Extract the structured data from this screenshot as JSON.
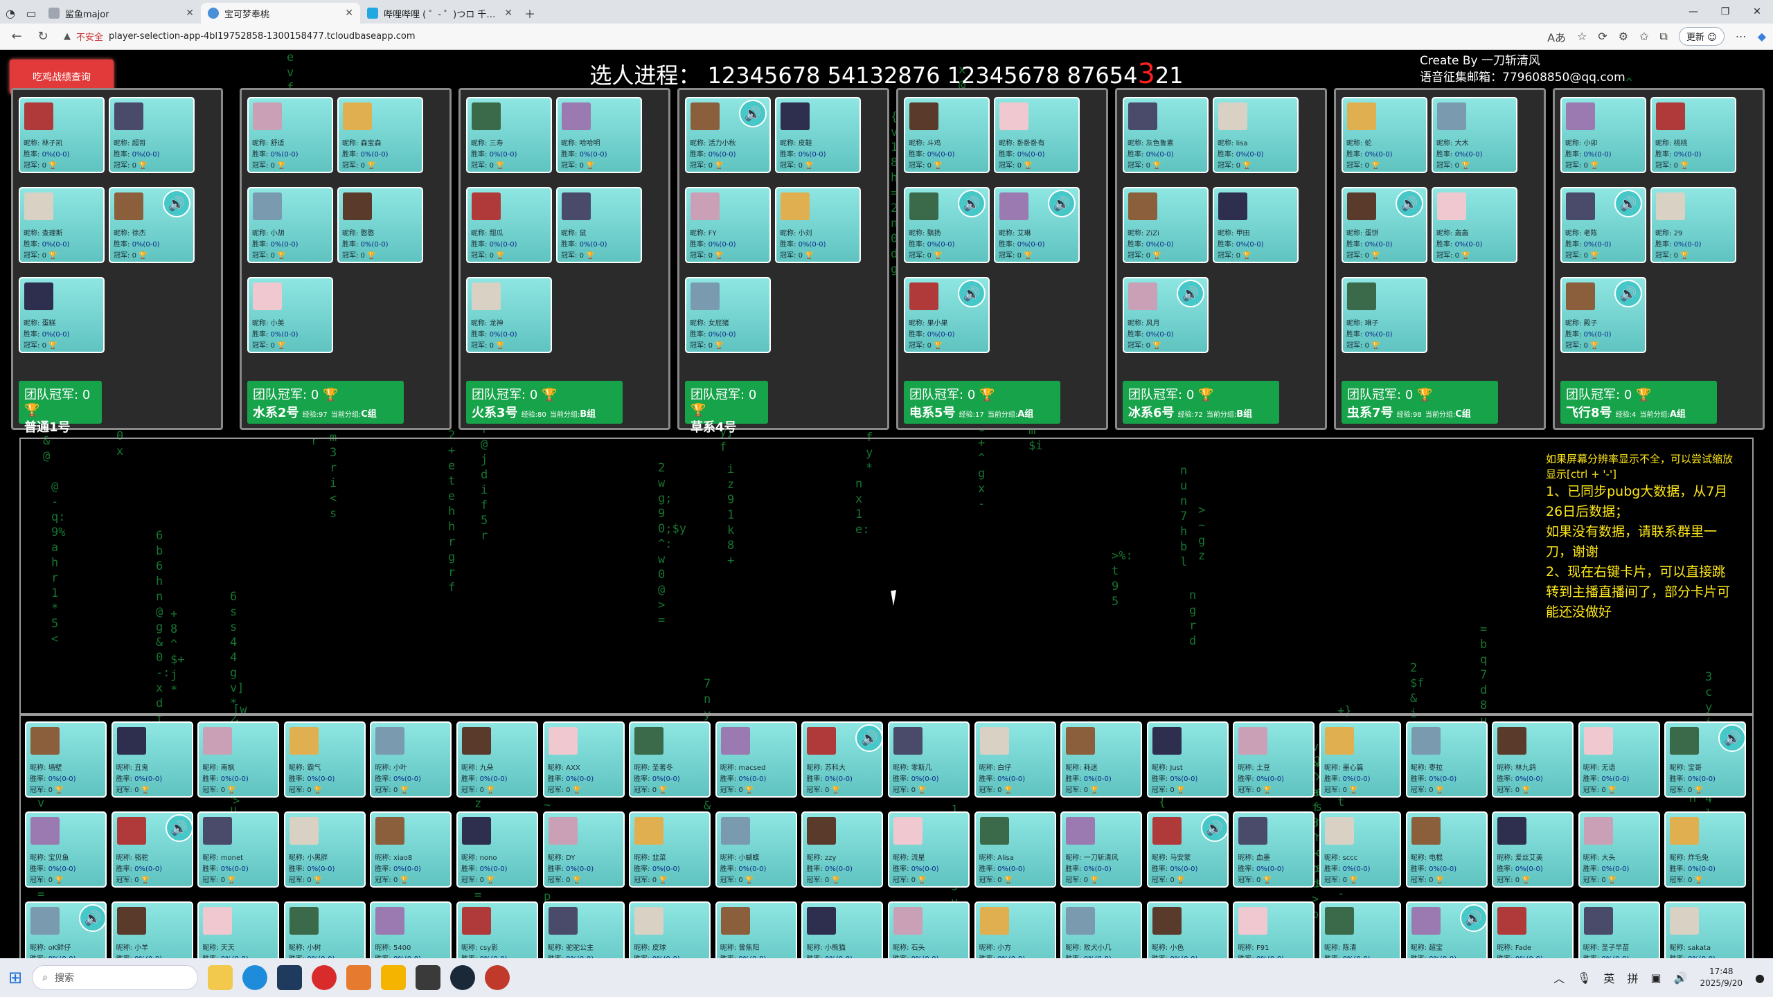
{
  "browser": {
    "tabs": [
      {
        "title": "鲨鱼major",
        "active": false
      },
      {
        "title": "宝可梦奉桃",
        "active": true
      },
      {
        "title": "哔哩哔哩 ( ゜- ゜)つロ 千杯~-bilibili",
        "active": false
      }
    ],
    "insecure_label": "不安全",
    "url": "player-selection-app-4bl19752858-1300158477.tcloudbaseapp.com",
    "update_label": "更新"
  },
  "header": {
    "query_button": "吃鸡战绩查询",
    "title_prefix": "选人进程：",
    "progress_before": "12345678 54132876 12345678 87654",
    "progress_highlight": "3",
    "progress_after": "21",
    "credit_line1": "Create By 一刀斩清风",
    "credit_line2": "语音征集邮箱：779608850@qq.com"
  },
  "labels": {
    "nick": "昵称:",
    "winrate": "胜率:",
    "champ": "冠军:",
    "team_champ": "团队冠军:",
    "exp": "经验:",
    "current_group": "当前分组:"
  },
  "teams": [
    {
      "name": "普通1号",
      "champions": "0",
      "extra": "",
      "group": "",
      "members": [
        {
          "nick": "林子凯",
          "winrate": "0%(0-0)",
          "champ": "0"
        },
        {
          "nick": "超哥",
          "winrate": "0%(0-0)",
          "champ": "0"
        },
        {
          "nick": "查理斯",
          "winrate": "0%(0-0)",
          "champ": "0",
          "speaker": false
        },
        {
          "nick": "徐杰",
          "winrate": "0%(0-0)",
          "champ": "0",
          "speaker": true
        },
        {
          "nick": "蛋糕",
          "winrate": "0%(0-0)",
          "champ": "0"
        }
      ]
    },
    {
      "name": "水系2号",
      "champions": "0",
      "extra": "97",
      "group": "C组",
      "members": [
        {
          "nick": "舒适",
          "winrate": "0%(0-0)",
          "champ": "0"
        },
        {
          "nick": "森宝森",
          "winrate": "0%(0-0)",
          "champ": "0"
        },
        {
          "nick": "小胡",
          "winrate": "0%(0-0)",
          "champ": "0"
        },
        {
          "nick": "憨憨",
          "winrate": "0%(0-0)",
          "champ": "0"
        },
        {
          "nick": "小美",
          "winrate": "0%(0-0)",
          "champ": "0"
        }
      ]
    },
    {
      "name": "火系3号",
      "champions": "0",
      "extra": "80",
      "group": "B组",
      "members": [
        {
          "nick": "三寿",
          "winrate": "0%(0-0)",
          "champ": "0"
        },
        {
          "nick": "哈哈明",
          "winrate": "0%(0-0)",
          "champ": "0"
        },
        {
          "nick": "甜瓜",
          "winrate": "0%(0-0)",
          "champ": "0"
        },
        {
          "nick": "鼠",
          "winrate": "0%(0-0)",
          "champ": "0"
        },
        {
          "nick": "龙神",
          "winrate": "0%(0-0)",
          "champ": "0"
        }
      ]
    },
    {
      "name": "草系4号",
      "champions": "0",
      "extra": "",
      "group": "",
      "members": [
        {
          "nick": "活力小秋",
          "winrate": "0%(0-0)",
          "champ": "0",
          "speaker": true
        },
        {
          "nick": "皮鞋",
          "winrate": "0%(0-0)",
          "champ": "0"
        },
        {
          "nick": "FY",
          "winrate": "0%(0-0)",
          "champ": "0"
        },
        {
          "nick": "小刘",
          "winrate": "0%(0-0)",
          "champ": "0"
        },
        {
          "nick": "女屁猪",
          "winrate": "0%(0-0)",
          "champ": "0"
        }
      ]
    },
    {
      "name": "电系5号",
      "champions": "0",
      "extra": "17",
      "group": "A组",
      "members": [
        {
          "nick": "斗鸡",
          "winrate": "0%(0-0)",
          "champ": "0"
        },
        {
          "nick": "卧卧卧有",
          "winrate": "0%(0-0)",
          "champ": "0"
        },
        {
          "nick": "飘扬",
          "winrate": "0%(0-0)",
          "champ": "0",
          "speaker": true
        },
        {
          "nick": "艾琳",
          "winrate": "0%(0-0)",
          "champ": "0",
          "speaker": true
        },
        {
          "nick": "果小果",
          "winrate": "0%(0-0)",
          "champ": "0",
          "speaker": true
        }
      ]
    },
    {
      "name": "冰系6号",
      "champions": "0",
      "extra": "72",
      "group": "B组",
      "members": [
        {
          "nick": "灰色鲁素",
          "winrate": "0%(0-0)",
          "champ": "0"
        },
        {
          "nick": "lisa",
          "winrate": "0%(0-0)",
          "champ": "0"
        },
        {
          "nick": "ZiZi",
          "winrate": "0%(0-0)",
          "champ": "0"
        },
        {
          "nick": "甲田",
          "winrate": "0%(0-0)",
          "champ": "0"
        },
        {
          "nick": "风月",
          "winrate": "0%(0-0)",
          "champ": "0",
          "speaker": true
        }
      ]
    },
    {
      "name": "虫系7号",
      "champions": "0",
      "extra": "98",
      "group": "C组",
      "members": [
        {
          "nick": "蛇",
          "winrate": "0%(0-0)",
          "champ": "0"
        },
        {
          "nick": "大木",
          "winrate": "0%(0-0)",
          "champ": "0"
        },
        {
          "nick": "蛋饼",
          "winrate": "0%(0-0)",
          "champ": "0",
          "speaker": true
        },
        {
          "nick": "轰轰",
          "winrate": "0%(0-0)",
          "champ": "0"
        },
        {
          "nick": "琳子",
          "winrate": "0%(0-0)",
          "champ": "0"
        }
      ]
    },
    {
      "name": "飞行8号",
      "champions": "0",
      "extra": "4",
      "group": "A组",
      "members": [
        {
          "nick": "小卯",
          "winrate": "0%(0-0)",
          "champ": "0"
        },
        {
          "nick": "桃桃",
          "winrate": "0%(0-0)",
          "champ": "0"
        },
        {
          "nick": "老陈",
          "winrate": "0%(0-0)",
          "champ": "0",
          "speaker": true
        },
        {
          "nick": "29",
          "winrate": "0%(0-0)",
          "champ": "0"
        },
        {
          "nick": "殿子",
          "winrate": "0%(0-0)",
          "champ": "0",
          "speaker": true
        }
      ]
    }
  ],
  "notice": {
    "line1": "如果屏幕分辨率显示不全，可以尝试缩放显示[ctrl + '-']",
    "line2": "1、已同步pubg大数据，从7月26日后数据；",
    "line3": "如果没有数据，请联系群里一刀，谢谢",
    "line4": "2、现在右键卡片，可以直接跳转到主播直播间了，部分卡片可能还没做好"
  },
  "pool": [
    {
      "nick": "墙壁"
    },
    {
      "nick": "丑鬼"
    },
    {
      "nick": "南枫"
    },
    {
      "nick": "霸气"
    },
    {
      "nick": "小叶"
    },
    {
      "nick": "九朵"
    },
    {
      "nick": "AXX"
    },
    {
      "nick": "圣著冬"
    },
    {
      "nick": "macsed"
    },
    {
      "nick": "苏科大",
      "speaker": true
    },
    {
      "nick": "零斯几"
    },
    {
      "nick": "白仔"
    },
    {
      "nick": "耗迷"
    },
    {
      "nick": "Just"
    },
    {
      "nick": "土豆"
    },
    {
      "nick": "墨心篇"
    },
    {
      "nick": "枣拉"
    },
    {
      "nick": "林九鸽"
    },
    {
      "nick": "无语"
    },
    {
      "nick": "宝哥",
      "speaker": true
    },
    {
      "nick": "宝贝鱼"
    },
    {
      "nick": "骆驼",
      "speaker": true
    },
    {
      "nick": "monet"
    },
    {
      "nick": "小黑胖"
    },
    {
      "nick": "xiao8"
    },
    {
      "nick": "nono"
    },
    {
      "nick": "DY"
    },
    {
      "nick": "韭菜"
    },
    {
      "nick": "小蝴蝶"
    },
    {
      "nick": "zzy"
    },
    {
      "nick": "流星"
    },
    {
      "nick": "Alisa"
    },
    {
      "nick": "一刀斩清风"
    },
    {
      "nick": "马安蒙",
      "speaker": true
    },
    {
      "nick": "血墨"
    },
    {
      "nick": "sccc"
    },
    {
      "nick": "电棍"
    },
    {
      "nick": "爱丝艾美"
    },
    {
      "nick": "大头"
    },
    {
      "nick": "炸毛兔"
    },
    {
      "nick": "oK鲜仔",
      "speaker": true
    },
    {
      "nick": "小羊"
    },
    {
      "nick": "天天"
    },
    {
      "nick": "小树"
    },
    {
      "nick": "5400"
    },
    {
      "nick": "csy影"
    },
    {
      "nick": "驼驼公主"
    },
    {
      "nick": "皮球"
    },
    {
      "nick": "曾焦阳"
    },
    {
      "nick": "小熊猫"
    },
    {
      "nick": "石头"
    },
    {
      "nick": "小方"
    },
    {
      "nick": "败犬小几"
    },
    {
      "nick": "小色"
    },
    {
      "nick": "F91"
    },
    {
      "nick": "陈清"
    },
    {
      "nick": "超宝",
      "speaker": true
    },
    {
      "nick": "Fade"
    },
    {
      "nick": "圣子早苗"
    },
    {
      "nick": "sakata"
    }
  ],
  "pool_defaults": {
    "winrate": "0%(0-0)",
    "champ": "0"
  },
  "taskbar": {
    "search_placeholder": "搜索",
    "ime1": "英",
    "ime2": "拼",
    "time": "17:48",
    "date": "2025/9/20"
  },
  "colors": {
    "card": "#7fdcd8",
    "footer": "#16a34a",
    "highlight": "#ff2020",
    "notice": "#ffe81a",
    "matrix": "#1c8a3a"
  }
}
